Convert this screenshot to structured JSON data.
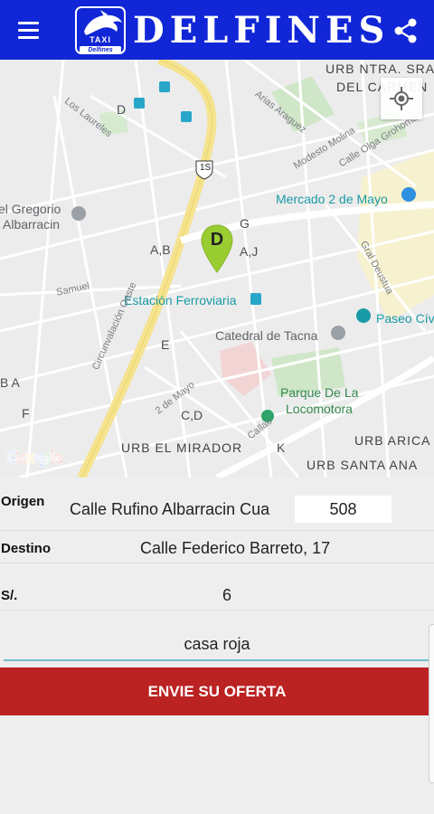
{
  "app": {
    "title": "DELFINES",
    "logo_top": "TAXI",
    "logo_bottom": "Delfines"
  },
  "icons": {
    "menu": "menu-icon",
    "share": "share-icon",
    "logo": "dolphin-logo-icon",
    "my_location": "my-location-icon",
    "pin": "map-pin-icon"
  },
  "colors": {
    "appbar": "#1126d6",
    "pin": "#9acd32",
    "button": "#bb2222",
    "underline": "#74c0c4"
  },
  "map": {
    "labels": {
      "urb_ntra_1": "URB NTRA. SRA.",
      "urb_ntra_2": "DEL CARMEN",
      "d_top": "D",
      "los_laureles": "Los Laureles",
      "arias_araguez": "Arias Araguez",
      "modesto_molina": "Modesto Molina",
      "olga_grohoman": "Calle Olga Grohoman",
      "route_15": "1S",
      "mercado": "Mercado 2 de Mayo",
      "gregorio_1": "el Gregorio",
      "gregorio_2": "Albarracin",
      "g": "G",
      "ab": "A,B",
      "aj": "A,J",
      "gral_deustua": "Gral Deustua",
      "samuel": "Samuel",
      "estacion": "Estación Ferroviaria",
      "paseo": "Paseo Cív",
      "e": "E",
      "circunvalacion": "Circunvalación Oeste",
      "catedral": "Catedral de Tacna",
      "ba": "B A",
      "dos_de_mayo": "2 de Mayo",
      "parque_1": "Parque De La",
      "parque_2": "Locomotora",
      "f": "F",
      "cd": "C,D",
      "callao": "Callao",
      "urb_arica": "URB ARICA",
      "urb_mirador": "URB EL MIRADOR",
      "k": "K",
      "urb_santa_ana": "URB SANTA ANA",
      "google": "Google"
    },
    "pin_letter": "D"
  },
  "form": {
    "origin_label": "Origen",
    "origin_value": "Calle Rufino Albarracin Cua",
    "origin_number": "508",
    "destination_label": "Destino",
    "destination_value": "Calle Federico Barreto, 17",
    "price_label": "S/.",
    "price_value": "6",
    "reference_value": "casa roja",
    "submit_label": "ENVIE SU OFERTA"
  }
}
